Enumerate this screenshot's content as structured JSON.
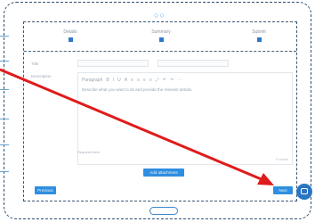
{
  "wizard": {
    "steps": [
      {
        "label": "Details"
      },
      {
        "label": "Summary"
      },
      {
        "label": "Submit"
      }
    ]
  },
  "form": {
    "title_label": "Title",
    "title_value": "",
    "type_label": "",
    "description_label": "Description",
    "toolbar": [
      "Paragraph",
      "B",
      "I",
      "U",
      "A",
      "≡",
      "≡",
      "≡",
      "≡",
      "⤢",
      "↶",
      "↷",
      "⋯"
    ],
    "description_value": "Describe what you want to do and provide the relevant details.",
    "char_count": "0 words",
    "hint": "Required field"
  },
  "buttons": {
    "previous": "Previous",
    "add": "Add attachment",
    "next": "Next"
  },
  "colors": {
    "accent": "#2f8ee0",
    "annotation_arrow": "#e01b1b"
  }
}
